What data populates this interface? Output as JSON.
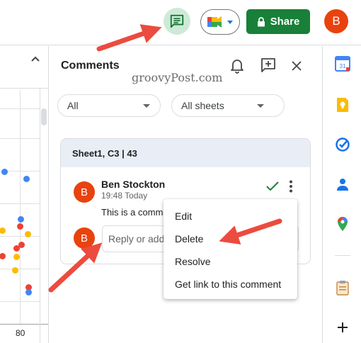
{
  "topbar": {
    "share_label": "Share",
    "avatar_initial": "B",
    "comments_icon": "comment-icon",
    "meet_icon": "google-meet-icon"
  },
  "sheet": {
    "axis_tick": "80",
    "dot_colors": [
      "#4285f4",
      "#ea4335",
      "#fbbc04"
    ]
  },
  "panel": {
    "title": "Comments",
    "watermark": "groovyPost.com",
    "filter_all": "All",
    "filter_sheets": "All sheets"
  },
  "comment": {
    "location": "Sheet1, C3 | 43",
    "author": "Ben Stockton",
    "time": "19:48 Today",
    "text": "This is a comme",
    "avatar_initial": "B",
    "reply_placeholder": "Reply or add"
  },
  "menu": {
    "items": [
      "Edit",
      "Delete",
      "Resolve",
      "Get link to this comment"
    ]
  },
  "sidebar": {
    "icons": [
      "calendar-icon",
      "keep-icon",
      "tasks-icon",
      "contacts-icon",
      "maps-icon",
      "clipboard-icon",
      "add-icon"
    ],
    "calendar_day": "31"
  },
  "colors": {
    "share_green": "#188038",
    "avatar_orange": "#e8430e",
    "arrow_red": "#ec4b3f",
    "comments_active_bg": "#ceead6"
  }
}
